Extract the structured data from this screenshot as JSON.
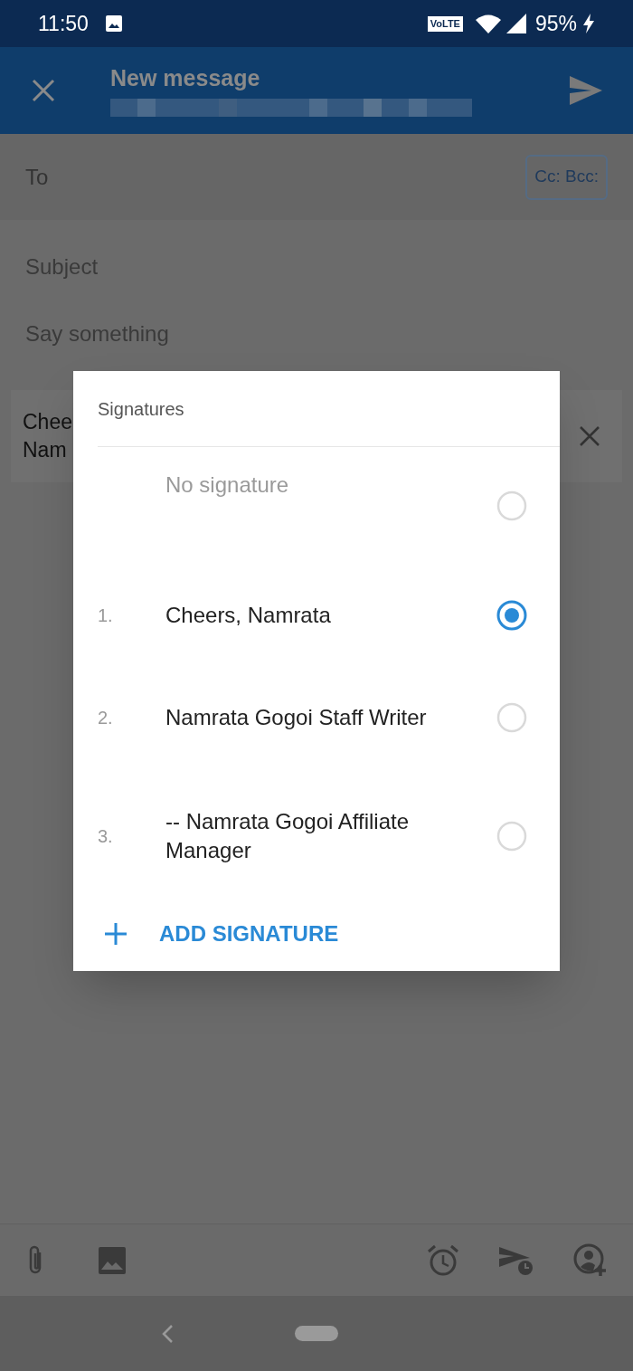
{
  "status_bar": {
    "time": "11:50",
    "network_badge": "VoLTE",
    "battery": "95%"
  },
  "header": {
    "title": "New message"
  },
  "compose": {
    "to_label": "To",
    "cc_button": "Cc: Bcc:",
    "subject_placeholder": "Subject",
    "body_placeholder": "Say something",
    "signature_preview": [
      "Chee",
      "Nam"
    ]
  },
  "dialog": {
    "title": "Signatures",
    "options": [
      {
        "kind": "none",
        "label": "No signature",
        "selected": false
      },
      {
        "kind": "numbered",
        "number": "1.",
        "label": "Cheers, Namrata",
        "selected": true
      },
      {
        "kind": "numbered",
        "number": "2.",
        "label": "Namrata Gogoi Staff Writer",
        "selected": false
      },
      {
        "kind": "numbered",
        "number": "3.",
        "label": "-- Namrata Gogoi Affiliate Manager",
        "selected": false
      }
    ],
    "add_button": "ADD SIGNATURE"
  }
}
